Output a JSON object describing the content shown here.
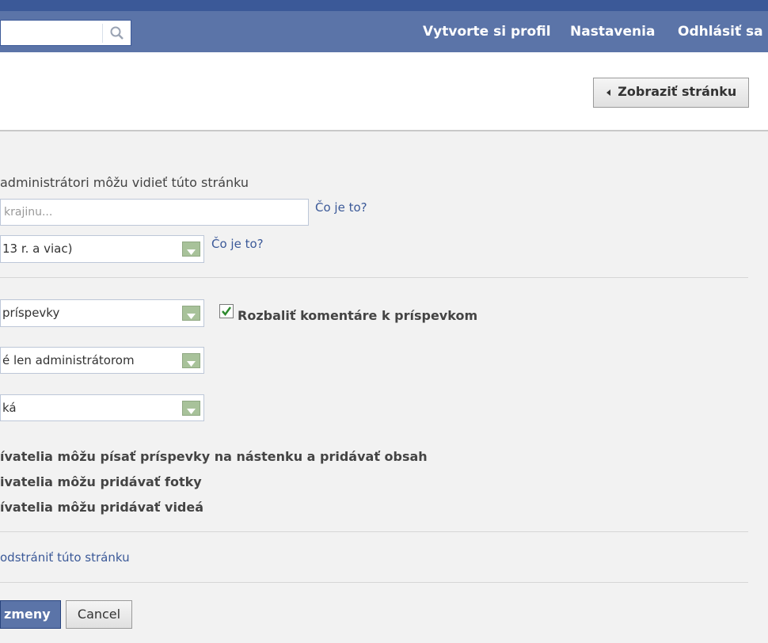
{
  "topbar": {
    "search_placeholder": "",
    "links": [
      "Vytvorte si profil",
      "Nastavenia",
      "Odhlásiť sa"
    ]
  },
  "header": {
    "view_page_button": "Zobraziť stránku"
  },
  "settings": {
    "visibility_label_prefix": "administrátori môžu vidieť túto stránku",
    "country_input_placeholder": "krajinu...",
    "country_help": "Čo je to?",
    "age_select_value": "13 r. a viac)",
    "age_help": "Čo je to?",
    "posts_select_value": "príspevky",
    "expand_comments_label": "Rozbaliť komentáre k príspevkom",
    "expand_comments_checked": true,
    "admins_select_value": "é len administrátorom",
    "third_select_value": "ká",
    "permissions": [
      "ívatelia môžu písať príspevky na nástenku a pridávať obsah",
      "ivatelia môžu pridávať fotky",
      "ívatelia môžu pridávať videá"
    ],
    "delete_link": "odstrániť túto stránku"
  },
  "footer": {
    "save_button": "zmeny",
    "cancel_button": "Cancel"
  },
  "colors": {
    "topbar": "#5b74a8",
    "topbar_stripe": "#3b5998",
    "link": "#3b5998",
    "select_arrow": "#a8c29a"
  },
  "icons": [
    "search-icon",
    "chevron-down-icon",
    "arrow-left-icon",
    "checkmark-icon"
  ]
}
